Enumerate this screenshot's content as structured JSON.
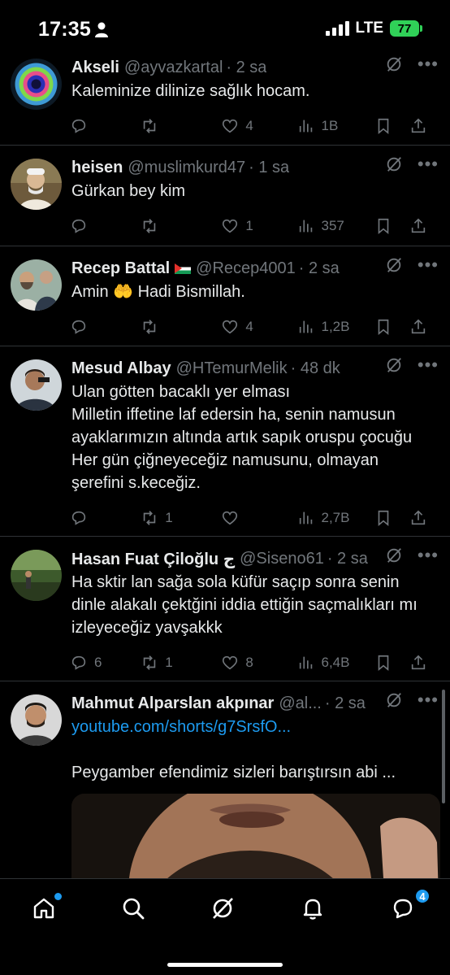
{
  "status_bar": {
    "time": "17:35",
    "network": "LTE",
    "battery": "77"
  },
  "icons": {
    "reply": "reply-icon",
    "retweet": "retweet-icon",
    "like": "heart-icon",
    "views": "views-icon",
    "bookmark": "bookmark-icon",
    "share": "share-icon",
    "grok": "grok-icon",
    "more": "more-icon"
  },
  "colors": {
    "background": "#000000",
    "accent": "#1d9bf0",
    "muted": "#71767b",
    "battery": "#30d158"
  },
  "tweets": [
    {
      "name": "Akseli",
      "handle": "@ayvazkartal",
      "time": "· 2 sa",
      "text": "Kaleminize dilinize sağlık hocam.",
      "replies": "",
      "retweets": "",
      "likes": "4",
      "views": "1B"
    },
    {
      "name": "heisen",
      "handle": "@muslimkurd47",
      "time": "· 1 sa",
      "text": "Gürkan bey kim",
      "replies": "",
      "retweets": "",
      "likes": "1",
      "views": "357"
    },
    {
      "name": "Recep Battal",
      "handle": "@Recep4001",
      "time": "· 2 sa",
      "text": "Amin 🤲 Hadi Bismillah.",
      "replies": "",
      "retweets": "",
      "likes": "4",
      "views": "1,2B"
    },
    {
      "name": "Mesud Albay",
      "handle": "@HTemurMelik",
      "time": "· 48 dk",
      "text": "Ulan götten bacaklı yer elması\nMilletin iffetine laf edersin ha, senin namusun ayaklarımızın altında artık sapık oruspu çocuğu\nHer gün çiğneyeceğiz namusunu, olmayan şerefini s.keceğiz.",
      "replies": "",
      "retweets": "1",
      "likes": "",
      "views": "2,7B"
    },
    {
      "name": "Hasan Fuat Çiloğlu ج",
      "handle": "@Siseno61",
      "time": "· 2 sa",
      "text": "Ha sktir lan sağa sola küfür saçıp sonra senin dinle alakalı çektğini iddia ettiğin saçmalıkları mı izleyeceğiz yavşakkk",
      "replies": "6",
      "retweets": "1",
      "likes": "8",
      "views": "6,4B"
    },
    {
      "name": "Mahmut Alparslan akpınar",
      "handle": "@al...",
      "time": "· 2 sa",
      "link": "youtube.com/shorts/g7SrsfO...",
      "text": "Peygamber efendimiz sizleri barıştırsın abi ..."
    }
  ],
  "bottom_nav": {
    "messages_badge": "4"
  }
}
